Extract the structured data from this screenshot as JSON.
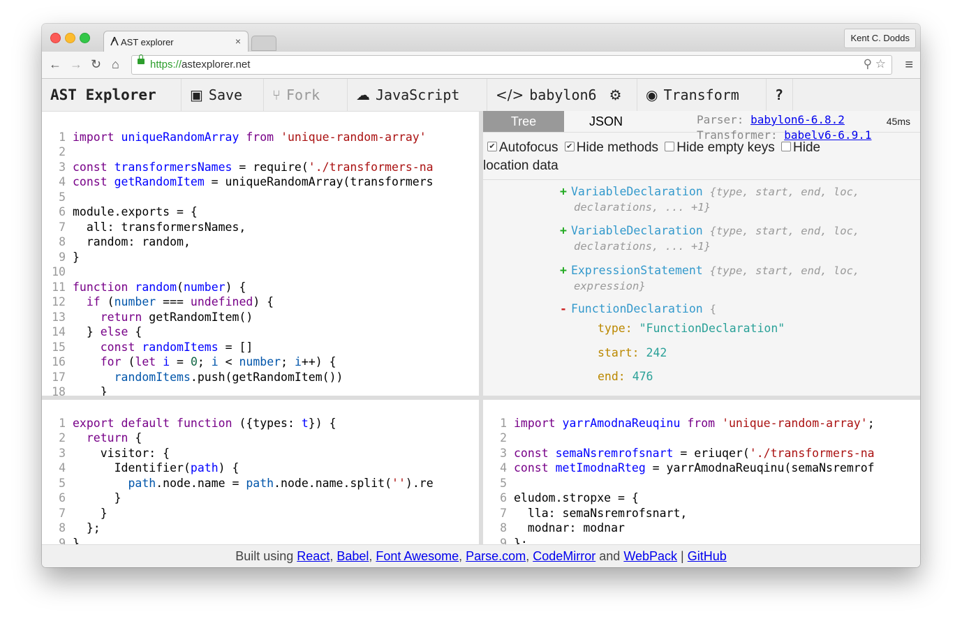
{
  "browser": {
    "tab_title": "AST explorer",
    "tab_close": "×",
    "user_name": "Kent C. Dodds",
    "url_scheme": "https://",
    "url_host": "astexplorer.net"
  },
  "toolbar": {
    "brand": "AST Explorer",
    "save": "Save",
    "fork": "Fork",
    "language": "JavaScript",
    "parser": "babylon6",
    "transform": "Transform",
    "help": "?"
  },
  "tree_panel": {
    "tab_tree": "Tree",
    "tab_json": "JSON",
    "parser_label": "Parser:",
    "parser_link": "babylon6-6.8.2",
    "transformer_label": "Transformer:",
    "transformer_link": "babelv6-6.9.1",
    "time": "45ms",
    "opt_autofocus": "Autofocus",
    "opt_hide_methods": "Hide methods",
    "opt_hide_empty": "Hide empty keys",
    "opt_hide_location": "Hide",
    "opt_hide_location_2": "location data",
    "nodes": [
      {
        "toggle": "+",
        "name": "VariableDeclaration",
        "summary": "{type, start, end, loc,",
        "summary2": "declarations, ... +1}"
      },
      {
        "toggle": "+",
        "name": "VariableDeclaration",
        "summary": "{type, start, end, loc,",
        "summary2": "declarations, ... +1}"
      },
      {
        "toggle": "+",
        "name": "ExpressionStatement",
        "summary": "{type, start, end, loc,",
        "summary2": "expression}"
      },
      {
        "toggle": "-",
        "name": "FunctionDeclaration",
        "summary": "{",
        "summary2": ""
      }
    ],
    "props": [
      {
        "key": "type:",
        "value": "\"FunctionDeclaration\""
      },
      {
        "key": "start:",
        "value": "242"
      },
      {
        "key": "end:",
        "value": "476"
      }
    ]
  },
  "footer": {
    "prefix": "Built using",
    "react": "React",
    "babel": "Babel",
    "fontawesome": "Font Awesome",
    "parse": "Parse.com",
    "codemirror": "CodeMirror",
    "and": "and",
    "webpack": "WebPack",
    "sep": "|",
    "github": "GitHub"
  }
}
